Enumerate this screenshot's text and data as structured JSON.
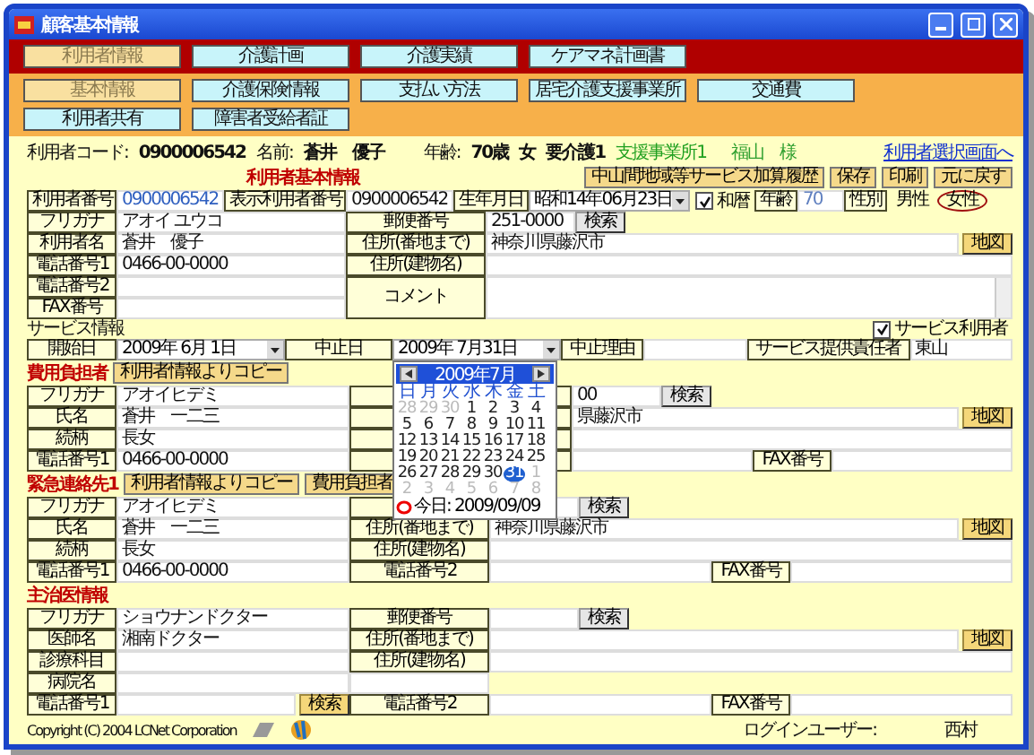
{
  "window": {
    "title": "顧客基本情報"
  },
  "main_tabs": [
    {
      "label": "利用者情報",
      "selected": true
    },
    {
      "label": "介護計画",
      "selected": false
    },
    {
      "label": "介護実績",
      "selected": false
    },
    {
      "label": "ケアマネ計画書",
      "selected": false
    }
  ],
  "sub_tabs": [
    {
      "label": "基本情報",
      "selected": true
    },
    {
      "label": "介護保険情報",
      "selected": false
    },
    {
      "label": "支払い方法",
      "selected": false
    },
    {
      "label": "居宅介護支援事業所",
      "selected": false
    },
    {
      "label": "交通費",
      "selected": false
    },
    {
      "label": "利用者共有",
      "selected": false
    },
    {
      "label": "障害者受給者証",
      "selected": false
    }
  ],
  "user_bar": {
    "code_label": "利用者コード:",
    "code": "0900006542",
    "name_label": "名前:",
    "name": "蒼井　優子",
    "age_label": "年齢:",
    "age": "70歳",
    "sex": "女",
    "care_level": "要介護1",
    "office": "支援事業所1",
    "staff": "福山　様",
    "link": "利用者選択画面へ"
  },
  "basic": {
    "title": "利用者基本情報",
    "buttons": [
      {
        "label": "中山間地域等サービス加算履歴"
      },
      {
        "label": "保存"
      },
      {
        "label": "印刷"
      },
      {
        "label": "元に戻す"
      }
    ],
    "user_no": {
      "label": "利用者番号",
      "value": "0900006542"
    },
    "display_no": {
      "label": "表示利用者番号",
      "value": "0900006542"
    },
    "birth": {
      "label": "生年月日",
      "value": "昭和14年06月23日",
      "wareki": {
        "label": "和暦",
        "checked": true
      }
    },
    "age": {
      "label": "年齢",
      "value": "70"
    },
    "sex": {
      "label": "性別",
      "options": [
        {
          "label": "男性",
          "selected": false
        },
        {
          "label": "女性",
          "selected": true
        }
      ]
    },
    "rows": [
      {
        "cells": [
          {
            "kind": "label",
            "text": "フリガナ"
          },
          {
            "kind": "field",
            "text": "アオイ ユウコ"
          },
          {
            "kind": "label",
            "text": "郵便番号"
          },
          {
            "kind": "group",
            "items": [
              {
                "kind": "short",
                "text": "251-0000"
              },
              {
                "kind": "gray",
                "text": "検索"
              }
            ]
          }
        ]
      },
      {
        "cells": [
          {
            "kind": "label",
            "text": "利用者名"
          },
          {
            "kind": "field",
            "text": "蒼井　優子"
          },
          {
            "kind": "label",
            "text": "住所(番地まで)"
          },
          {
            "kind": "group",
            "items": [
              {
                "kind": "field",
                "text": "神奈川県藤沢市"
              },
              {
                "kind": "map",
                "text": "地図"
              }
            ]
          }
        ]
      },
      {
        "cells": [
          {
            "kind": "label",
            "text": "電話番号1"
          },
          {
            "kind": "field",
            "text": "0466-00-0000"
          },
          {
            "kind": "label",
            "text": "住所(建物名)"
          },
          {
            "kind": "field"
          }
        ]
      },
      {
        "cells": [
          {
            "kind": "label",
            "text": "電話番号2"
          },
          {
            "kind": "field"
          },
          {
            "kind": "comment",
            "text": "コメント"
          },
          {
            "kind": "memo"
          }
        ]
      },
      {
        "cells": [
          {
            "kind": "label",
            "text": "FAX番号"
          },
          {
            "kind": "field"
          }
        ]
      }
    ]
  },
  "service": {
    "title": "サービス情報",
    "service_user": {
      "label": "サービス利用者",
      "checked": true
    },
    "cells": [
      {
        "kind": "label",
        "text": "開始日"
      },
      {
        "kind": "select",
        "text": "2009年 6月 1日"
      },
      {
        "kind": "label",
        "text": "中止日"
      },
      {
        "kind": "select",
        "text": "2009年 7月31日",
        "calendar": {
          "month": "2009年7月",
          "weekdays": [
            "日",
            "月",
            "火",
            "水",
            "木",
            "金",
            "土"
          ],
          "today": "今日: 2009/09/09",
          "days": [
            {
              "text": "28",
              "in_month": false,
              "selected": false
            },
            {
              "text": "29",
              "in_month": false,
              "selected": false
            },
            {
              "text": "30",
              "in_month": false,
              "selected": false
            },
            {
              "text": "1",
              "in_month": true,
              "selected": false
            },
            {
              "text": "2",
              "in_month": true,
              "selected": false
            },
            {
              "text": "3",
              "in_month": true,
              "selected": false
            },
            {
              "text": "4",
              "in_month": true,
              "selected": false
            },
            {
              "text": "5",
              "in_month": true,
              "selected": false
            },
            {
              "text": "6",
              "in_month": true,
              "selected": false
            },
            {
              "text": "7",
              "in_month": true,
              "selected": false
            },
            {
              "text": "8",
              "in_month": true,
              "selected": false
            },
            {
              "text": "9",
              "in_month": true,
              "selected": false
            },
            {
              "text": "10",
              "in_month": true,
              "selected": false
            },
            {
              "text": "11",
              "in_month": true,
              "selected": false
            },
            {
              "text": "12",
              "in_month": true,
              "selected": false
            },
            {
              "text": "13",
              "in_month": true,
              "selected": false
            },
            {
              "text": "14",
              "in_month": true,
              "selected": false
            },
            {
              "text": "15",
              "in_month": true,
              "selected": false
            },
            {
              "text": "16",
              "in_month": true,
              "selected": false
            },
            {
              "text": "17",
              "in_month": true,
              "selected": false
            },
            {
              "text": "18",
              "in_month": true,
              "selected": false
            },
            {
              "text": "19",
              "in_month": true,
              "selected": false
            },
            {
              "text": "20",
              "in_month": true,
              "selected": false
            },
            {
              "text": "21",
              "in_month": true,
              "selected": false
            },
            {
              "text": "22",
              "in_month": true,
              "selected": false
            },
            {
              "text": "23",
              "in_month": true,
              "selected": false
            },
            {
              "text": "24",
              "in_month": true,
              "selected": false
            },
            {
              "text": "25",
              "in_month": true,
              "selected": false
            },
            {
              "text": "26",
              "in_month": true,
              "selected": false
            },
            {
              "text": "27",
              "in_month": true,
              "selected": false
            },
            {
              "text": "28",
              "in_month": true,
              "selected": false
            },
            {
              "text": "29",
              "in_month": true,
              "selected": false
            },
            {
              "text": "30",
              "in_month": true,
              "selected": false
            },
            {
              "text": "31",
              "in_month": true,
              "selected": true
            },
            {
              "text": "1",
              "in_month": false,
              "selected": false
            },
            {
              "text": "2",
              "in_month": false,
              "selected": false
            },
            {
              "text": "3",
              "in_month": false,
              "selected": false
            },
            {
              "text": "4",
              "in_month": false,
              "selected": false
            },
            {
              "text": "5",
              "in_month": false,
              "selected": false
            },
            {
              "text": "6",
              "in_month": false,
              "selected": false
            },
            {
              "text": "7",
              "in_month": false,
              "selected": false
            },
            {
              "text": "8",
              "in_month": false,
              "selected": false
            }
          ]
        }
      },
      {
        "kind": "label",
        "text": "中止理由"
      },
      {
        "kind": "field"
      },
      {
        "kind": "label",
        "text": "サービス提供責任者"
      },
      {
        "kind": "field",
        "text": "東山"
      }
    ]
  },
  "blocks": [
    {
      "title": "費用負担者",
      "buttons": [
        {
          "label": "利用者情報よりコピー"
        }
      ],
      "rows": [
        {
          "cells": [
            {
              "kind": "label",
              "text": "フリガナ"
            },
            {
              "kind": "field",
              "text": "アオイヒデミ"
            },
            {
              "kind": "label"
            },
            {
              "kind": "group",
              "items": [
                {
                  "kind": "short",
                  "text": "00"
                },
                {
                  "kind": "gray",
                  "text": "検索"
                }
              ]
            }
          ]
        },
        {
          "cells": [
            {
              "kind": "label",
              "text": "氏名"
            },
            {
              "kind": "field",
              "text": "蒼井　一二三"
            },
            {
              "kind": "label"
            },
            {
              "kind": "group",
              "items": [
                {
                  "kind": "field",
                  "text": "県藤沢市"
                },
                {
                  "kind": "map",
                  "text": "地図"
                }
              ]
            }
          ]
        },
        {
          "cells": [
            {
              "kind": "label",
              "text": "続柄"
            },
            {
              "kind": "field",
              "text": "長女"
            },
            {
              "kind": "label"
            },
            {
              "kind": "field"
            }
          ]
        },
        {
          "cells": [
            {
              "kind": "label",
              "text": "電話番号1"
            },
            {
              "kind": "field",
              "text": "0466-00-0000"
            },
            {
              "kind": "label"
            },
            {
              "kind": "group",
              "items": [
                {
                  "kind": "field"
                },
                {
                  "kind": "label",
                  "text": "FAX番号"
                },
                {
                  "kind": "field"
                }
              ]
            }
          ]
        }
      ]
    },
    {
      "title": "緊急連絡先1",
      "buttons": [
        {
          "label": "利用者情報よりコピー"
        },
        {
          "label": "費用負担者"
        }
      ],
      "rows": [
        {
          "cells": [
            {
              "kind": "label",
              "text": "フリガナ"
            },
            {
              "kind": "field",
              "text": "アオイヒデミ"
            },
            {
              "kind": "label"
            },
            {
              "kind": "group",
              "items": [
                {
                  "kind": "short"
                },
                {
                  "kind": "gray",
                  "text": "検索"
                }
              ]
            }
          ]
        },
        {
          "cells": [
            {
              "kind": "label",
              "text": "氏名"
            },
            {
              "kind": "field",
              "text": "蒼井　一二三"
            },
            {
              "kind": "label",
              "text": "住所(番地まで)"
            },
            {
              "kind": "group",
              "items": [
                {
                  "kind": "field",
                  "text": "神奈川県藤沢市"
                },
                {
                  "kind": "map",
                  "text": "地図"
                }
              ]
            }
          ]
        },
        {
          "cells": [
            {
              "kind": "label",
              "text": "続柄"
            },
            {
              "kind": "field",
              "text": "長女"
            },
            {
              "kind": "label",
              "text": "住所(建物名)"
            },
            {
              "kind": "field"
            }
          ]
        },
        {
          "cells": [
            {
              "kind": "label",
              "text": "電話番号1"
            },
            {
              "kind": "field",
              "text": "0466-00-0000"
            },
            {
              "kind": "label",
              "text": "電話番号2"
            },
            {
              "kind": "group",
              "items": [
                {
                  "kind": "field"
                },
                {
                  "kind": "label",
                  "text": "FAX番号"
                },
                {
                  "kind": "field"
                }
              ]
            }
          ]
        }
      ]
    },
    {
      "title": "主治医情報",
      "rows": [
        {
          "cells": [
            {
              "kind": "label",
              "text": "フリガナ"
            },
            {
              "kind": "field",
              "text": "ショウナンドクター"
            },
            {
              "kind": "label",
              "text": "郵便番号"
            },
            {
              "kind": "group",
              "items": [
                {
                  "kind": "short"
                },
                {
                  "kind": "gray",
                  "text": "検索"
                }
              ]
            }
          ]
        },
        {
          "cells": [
            {
              "kind": "label",
              "text": "医師名"
            },
            {
              "kind": "field",
              "text": "湘南ドクター"
            },
            {
              "kind": "label",
              "text": "住所(番地まで)"
            },
            {
              "kind": "group",
              "items": [
                {
                  "kind": "field"
                },
                {
                  "kind": "map",
                  "text": "地図"
                }
              ]
            }
          ]
        },
        {
          "cells": [
            {
              "kind": "label",
              "text": "診療科目"
            },
            {
              "kind": "field"
            },
            {
              "kind": "label",
              "text": "住所(建物名)"
            },
            {
              "kind": "field"
            }
          ]
        },
        {
          "cells": [
            {
              "kind": "label",
              "text": "病院名"
            },
            {
              "kind": "field"
            },
            {
              "kind": "field"
            },
            {
              "kind": "blank"
            }
          ]
        },
        {
          "cells": [
            {
              "kind": "label",
              "text": "電話番号1"
            },
            {
              "kind": "group",
              "items": [
                {
                  "kind": "field"
                },
                {
                  "kind": "yellow",
                  "text": "検索"
                }
              ]
            },
            {
              "kind": "label",
              "text": "電話番号2"
            },
            {
              "kind": "group",
              "items": [
                {
                  "kind": "field"
                },
                {
                  "kind": "label",
                  "text": "FAX番号"
                },
                {
                  "kind": "field"
                }
              ]
            }
          ]
        }
      ]
    }
  ],
  "footer": {
    "copyright": "Copyright (C) 2004 LCNet Corporation",
    "login_label": "ログインユーザー:",
    "login_user": "西村"
  }
}
